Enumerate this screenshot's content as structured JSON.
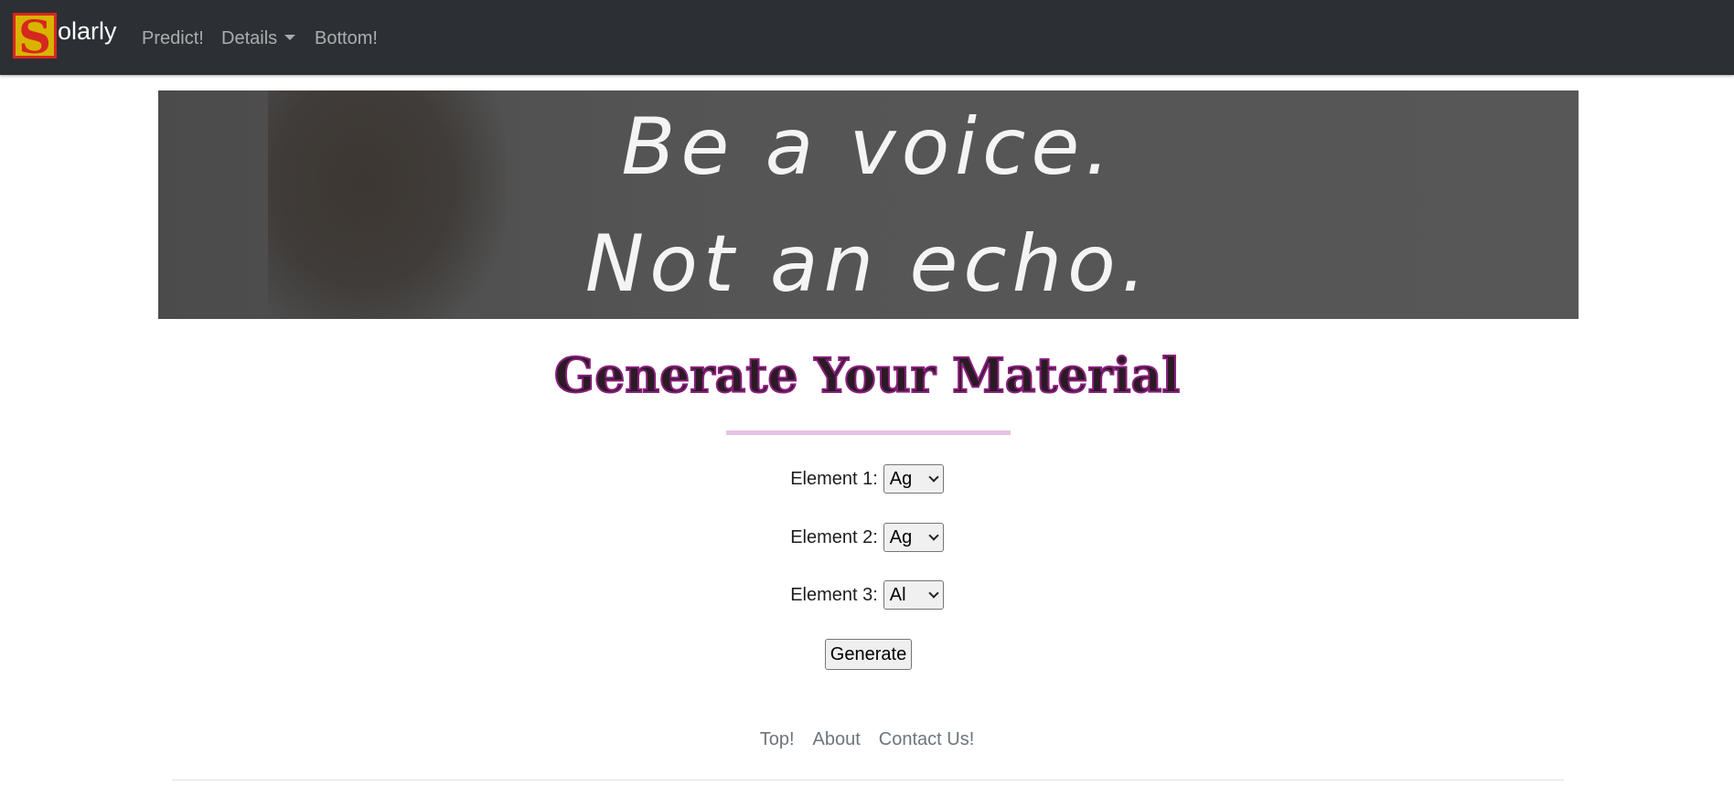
{
  "nav": {
    "brand_letter": "S",
    "brand_text": "olarly",
    "links": [
      "Predict!",
      "Details",
      "Bottom!"
    ]
  },
  "banner": {
    "line1": "Be a voice.",
    "line2": "Not an echo."
  },
  "main": {
    "title": "Generate Your Material",
    "fields": [
      {
        "label": "Element 1:",
        "value": "Ag"
      },
      {
        "label": "Element 2:",
        "value": "Ag"
      },
      {
        "label": "Element 3:",
        "value": "Al"
      }
    ],
    "generate_label": "Generate"
  },
  "footer": {
    "links": [
      "Top!",
      "About",
      "Contact Us!"
    ]
  },
  "colors": {
    "navbar": "#2c3035",
    "title_outline": "#8a1f7d",
    "divider": "#e6c3e4",
    "logo_bg": "#d8b400",
    "logo_red": "#d6271f"
  }
}
